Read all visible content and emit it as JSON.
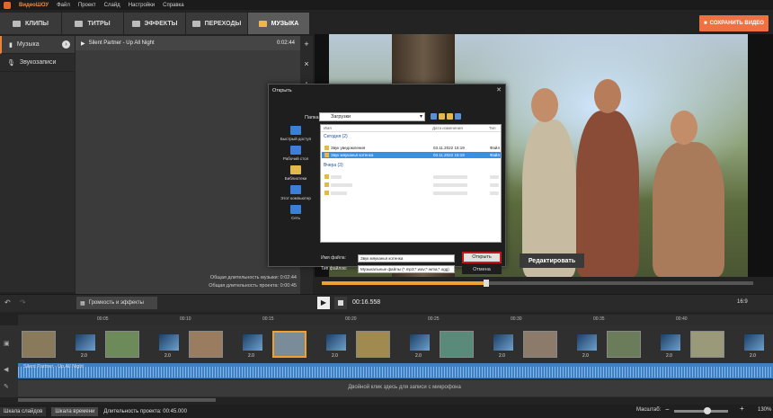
{
  "menubar": {
    "app": "ВидеоШОУ",
    "items": [
      "Файл",
      "Проект",
      "Слайд",
      "Настройки",
      "Справка"
    ]
  },
  "tabs": [
    {
      "label": "КЛИПЫ",
      "icon": "film-icon"
    },
    {
      "label": "ТИТРЫ",
      "icon": "text-icon"
    },
    {
      "label": "ЭФФЕКТЫ",
      "icon": "effects-icon"
    },
    {
      "label": "ПЕРЕХОДЫ",
      "icon": "transition-icon"
    },
    {
      "label": "МУЗЫКА",
      "icon": "music-icon"
    }
  ],
  "save_button": "СОХРАНИТЬ ВИДЕО",
  "left_panel": {
    "items": [
      "Музыка",
      "Звукозаписи"
    ]
  },
  "music_list": {
    "track_title": "Silent Partner - Up All Night",
    "track_duration": "0:02:44",
    "summary_music": "Общая длительность музыки: 0:02:44",
    "summary_project": "Общая длительность проекта: 0:00:45"
  },
  "preview": {
    "edit_button": "Редактировать",
    "progress_fraction": 0.38
  },
  "playback": {
    "volume_button": "Громкость и эффекты",
    "timecode": "00:16.558",
    "ratio": "16:9"
  },
  "timeline": {
    "ruler_marks": [
      "00:05",
      "00:10",
      "00:15",
      "00:20",
      "00:25",
      "00:30",
      "00:35",
      "00:40"
    ],
    "transition_duration": "2.0",
    "audio_track_label": "Silent Partner - Up All Night",
    "mic_hint": "Двойной клик здесь для записи с микрофона"
  },
  "statusbar": {
    "tab_slides": "Шкала слайдов",
    "tab_timeline": "Шкала времени",
    "duration": "Длительность проекта: 00:45.000",
    "zoom_label": "Масштаб:",
    "zoom_value": "130%"
  },
  "dialog": {
    "title": "Открыть",
    "folder_label": "Папка:",
    "folder_value": "Загрузки",
    "places": [
      "Быстрый доступ",
      "Рабочий стол",
      "Библиотеки",
      "Этот компьютер",
      "Сеть"
    ],
    "columns": [
      "Имя",
      "Дата изменения",
      "Тип"
    ],
    "group_today": "Сегодня (2)",
    "group_yesterday": "Вчера (3)",
    "files": [
      {
        "name": "Звук уведомления",
        "date": "03.11.2022 15:19",
        "type": "Файл"
      },
      {
        "name": "Звук мяуканья котенка",
        "date": "03.11.2022 15:19",
        "type": "Файл"
      }
    ],
    "filename_label": "Имя файла:",
    "filename_value": "Звук мяуканья котенка",
    "filetype_label": "Тип файлов:",
    "filetype_value": "Музыкальные файлы (*.mp3;*.wav;*.wma;*.ogg)",
    "open_button": "Открыть",
    "cancel_button": "Отмена"
  }
}
